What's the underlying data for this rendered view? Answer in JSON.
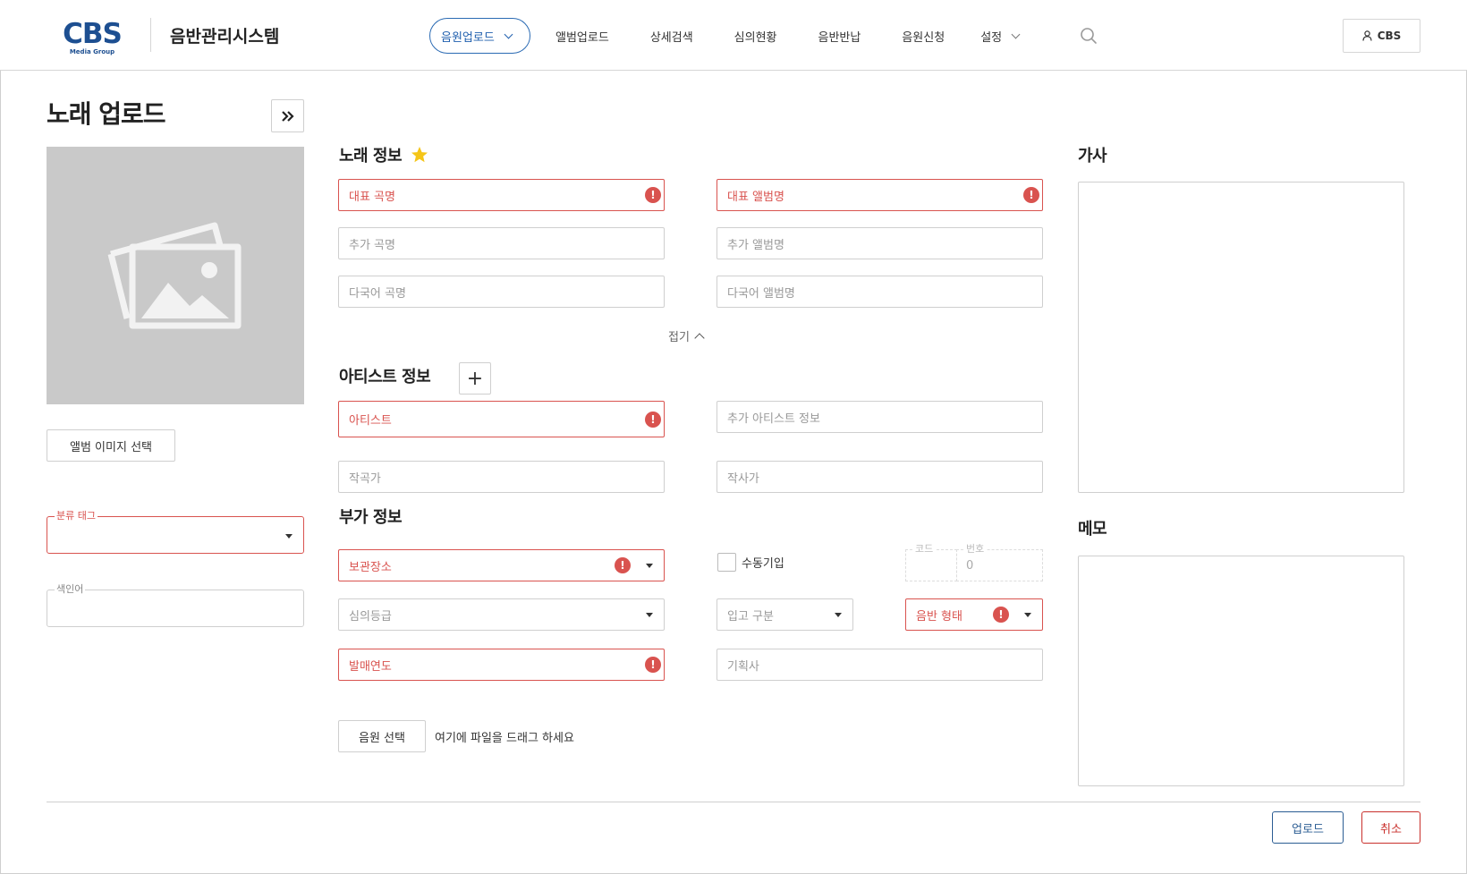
{
  "header": {
    "logo_text": "CBS",
    "logo_sub": "Media Group",
    "system_title": "음반관리시스템",
    "nav": [
      {
        "label": "음원업로드",
        "active": true,
        "has_dropdown": true
      },
      {
        "label": "앨범업로드"
      },
      {
        "label": "상세검색"
      },
      {
        "label": "심의현황"
      },
      {
        "label": "음반반납"
      },
      {
        "label": "음원신청"
      },
      {
        "label": "설정",
        "has_dropdown": true
      }
    ],
    "user_label": "CBS"
  },
  "left": {
    "page_title": "노래 업로드",
    "album_image_button": "앨범 이미지 선택",
    "category_tag_legend": "분류 태그",
    "index_word_legend": "색인어"
  },
  "song_info": {
    "title": "노래 정보",
    "main_title_placeholder": "대표 곡명",
    "main_album_placeholder": "대표 앨범명",
    "extra_title_placeholder": "추가 곡명",
    "extra_album_placeholder": "추가 앨범명",
    "multi_title_placeholder": "다국어 곡명",
    "multi_album_placeholder": "다국어 앨범명",
    "fold_label": "접기"
  },
  "artist_info": {
    "title": "아티스트 정보",
    "artist_placeholder": "아티스트",
    "extra_artist_placeholder": "추가 아티스트 정보",
    "composer_placeholder": "작곡가",
    "lyricist_placeholder": "작사가"
  },
  "extra_info": {
    "title": "부가 정보",
    "storage_placeholder": "보관장소",
    "manual_entry_label": "수동기입",
    "code_legend": "코드",
    "number_legend": "번호",
    "number_value": "0",
    "review_grade_placeholder": "심의등급",
    "receipt_type_placeholder": "입고 구분",
    "album_format_placeholder": "음반 형태",
    "release_year_placeholder": "발매연도",
    "agency_placeholder": "기획사"
  },
  "file": {
    "select_button": "음원 선택",
    "drop_text": "여기에 파일을 드래그 하세요"
  },
  "right": {
    "lyrics_title": "가사",
    "memo_title": "메모"
  },
  "actions": {
    "upload": "업로드",
    "cancel": "취소"
  },
  "colors": {
    "brand": "#1d4f91",
    "error": "#d9534f",
    "star": "#f5c518",
    "active_nav": "#1f5fae"
  }
}
